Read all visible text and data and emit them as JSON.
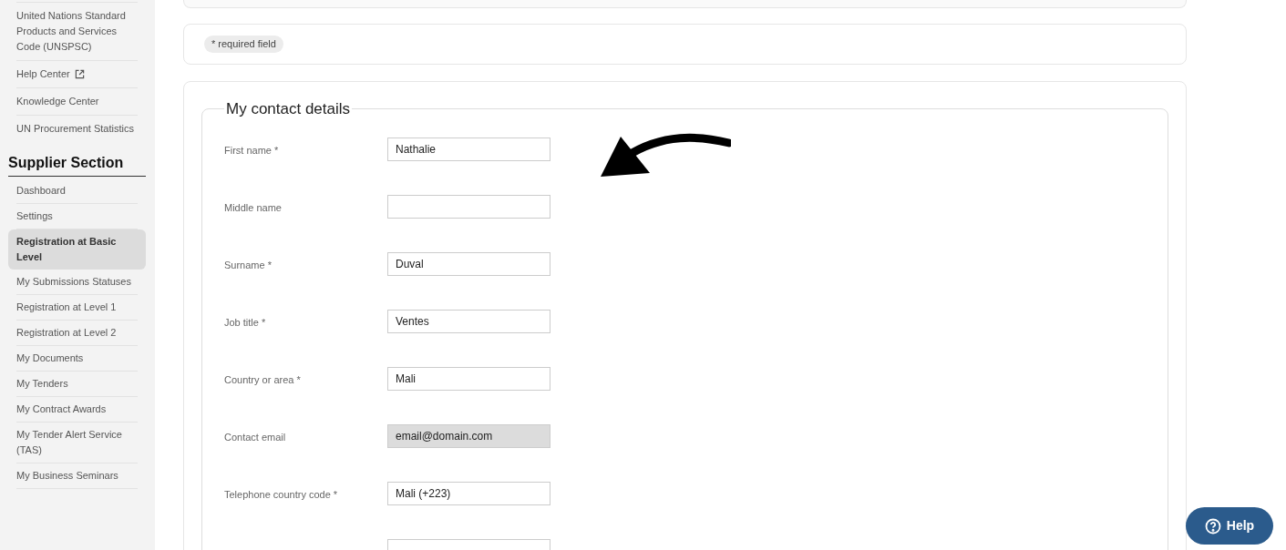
{
  "sidebar": {
    "top_items": [
      {
        "label": "United Nations Standard Products and Services Code (UNSPSC)",
        "external": false
      },
      {
        "label": "Help Center",
        "external": true
      },
      {
        "label": "Knowledge Center",
        "external": false
      },
      {
        "label": "UN Procurement Statistics",
        "external": false
      }
    ],
    "section_title": "Supplier Section",
    "items": [
      {
        "label": "Dashboard",
        "selected": false
      },
      {
        "label": "Settings",
        "selected": false
      },
      {
        "label": "Registration at Basic Level",
        "selected": true
      },
      {
        "label": "My Submissions Statuses",
        "selected": false
      },
      {
        "label": "Registration at Level 1",
        "selected": false
      },
      {
        "label": "Registration at Level 2",
        "selected": false
      },
      {
        "label": "My Documents",
        "selected": false
      },
      {
        "label": "My Tenders",
        "selected": false
      },
      {
        "label": "My Contract Awards",
        "selected": false
      },
      {
        "label": "My Tender Alert Service (TAS)",
        "selected": false
      },
      {
        "label": "My Business Seminars",
        "selected": false
      }
    ]
  },
  "required_note": "* required field",
  "contact_details": {
    "title": "My contact details",
    "fields": [
      {
        "label": "First name *",
        "value": "Nathalie",
        "disabled": false
      },
      {
        "label": "Middle name",
        "disabled": false
      },
      {
        "label": "Surname *",
        "value": "Duval",
        "disabled": false
      },
      {
        "label": "Job title *",
        "value": "Ventes",
        "disabled": false
      },
      {
        "label": "Country or area *",
        "value": "Mali",
        "disabled": false
      },
      {
        "label": "Contact email",
        "value": "email@domain.com",
        "disabled": true
      },
      {
        "label": "Telephone country code *",
        "value": "Mali (+223)",
        "disabled": false
      },
      {
        "disabled": false
      }
    ]
  },
  "help_button": "Help"
}
